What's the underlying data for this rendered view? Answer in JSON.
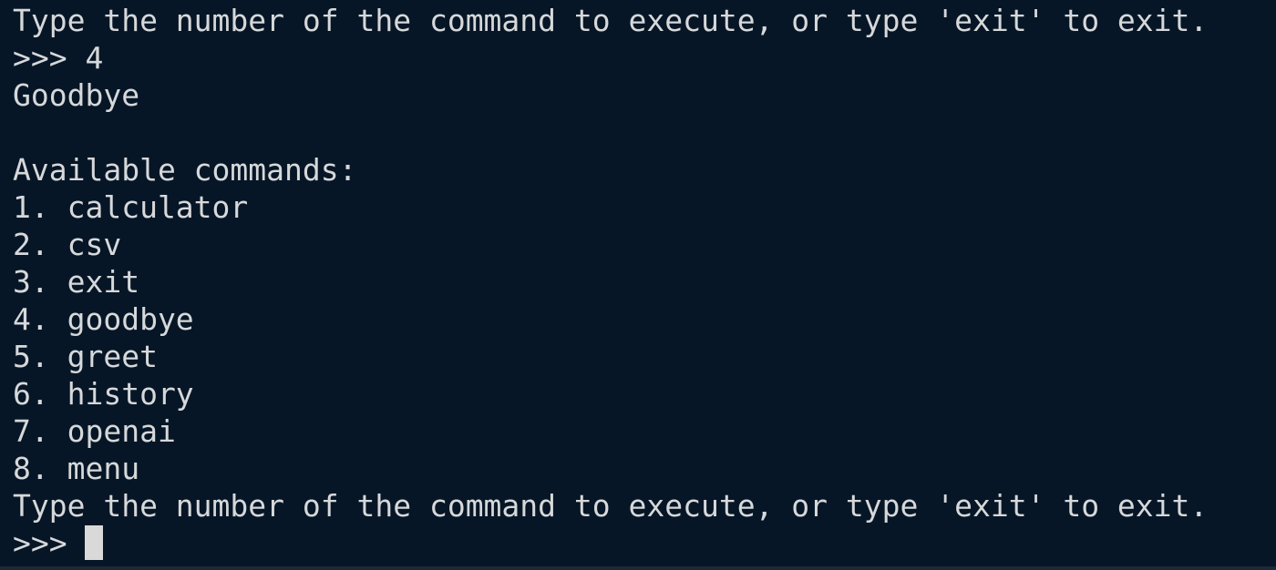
{
  "terminal": {
    "prompt_instruction_1": "Type the number of the command to execute, or type 'exit' to exit.",
    "prompt_symbol": ">>>",
    "entered_command": "4",
    "response": "Goodbye",
    "available_heading": "Available commands:",
    "commands": [
      "1. calculator",
      "2. csv",
      "3. exit",
      "4. goodbye",
      "5. greet",
      "6. history",
      "7. openai",
      "8. menu"
    ],
    "prompt_instruction_2": "Type the number of the command to execute, or type 'exit' to exit.",
    "current_input": ""
  },
  "colors": {
    "background": "#061626",
    "text": "#d6d8da",
    "cursor": "#d9d9d9"
  }
}
